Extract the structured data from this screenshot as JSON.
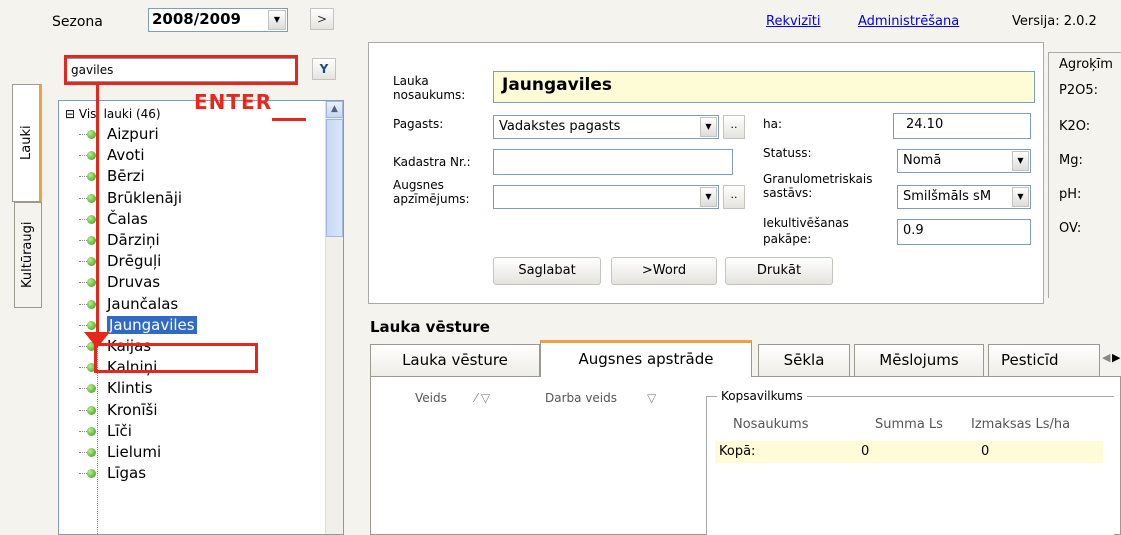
{
  "top": {
    "season_label": "Sezona",
    "season_value": "2008/2009",
    "next_btn": ">",
    "link_rekviziti": "Rekvizīti",
    "link_admin": "Administrēšana",
    "version": "Versija: 2.0.2"
  },
  "side_tabs": [
    "Lauki",
    "Kultūraugi"
  ],
  "search": {
    "value": "gaviles"
  },
  "annotation": {
    "enter": "ENTER"
  },
  "tree": {
    "root": "Visi lauki (46)",
    "items": [
      "Aizpuri",
      "Avoti",
      "Bērzi",
      "Brūklenāji",
      "Čalas",
      "Dārziņi",
      "Drēguļi",
      "Druvas",
      "Jaunčalas",
      "Jaungaviles",
      "Kaijas",
      "Kalniņi",
      "Klintis",
      "Kronīši",
      "Līči",
      "Lielumi",
      "Līgas"
    ],
    "selected": "Jaungaviles"
  },
  "form": {
    "name_label_1": "Lauka",
    "name_label_2": "nosaukums:",
    "name_value": "Jaungaviles",
    "pagasts_label": "Pagasts:",
    "pagasts_value": "Vadakstes pagasts",
    "ha_label": "ha:",
    "ha_value": "24.10",
    "kadastra_label": "Kadastra Nr.:",
    "kadastra_value": "",
    "statuss_label": "Statuss:",
    "statuss_value": "Nomā",
    "augsnes_label_1": "Augsnes",
    "augsnes_label_2": "apzīmējums:",
    "augsnes_value": "",
    "granulo_label_1": "Granulometriskais",
    "granulo_label_2": "sastāvs:",
    "granulo_value": "Smilšmāls sM",
    "iekult_label_1": "Iekultivēšanas",
    "iekult_label_2": "pakāpe:",
    "iekult_value": "0.9",
    "dots": "..",
    "btn_save": "Saglabat",
    "btn_word": ">Word",
    "btn_print": "Drukāt"
  },
  "agro": {
    "title": "Agroķīm",
    "rows": [
      "P2O5:",
      "K2O:",
      "Mg:",
      "pH:",
      "OV:"
    ]
  },
  "history": {
    "title": "Lauka vēsture",
    "tabs": [
      "Lauka vēsture",
      "Augsnes apstrāde",
      "Sēkla",
      "Mēslojums",
      "Pesticīd"
    ],
    "active_tab": "Augsnes apstrāde",
    "col_veids": "Veids",
    "col_darba": "Darba veids",
    "summary_title": "Kopsavilkums",
    "sum_col_name": "Nosaukums",
    "sum_col_sum": "Summa Ls",
    "sum_col_cost": "Izmaksas Ls/ha",
    "sum_row_label": "Kopā:",
    "sum_row_sum": "0",
    "sum_row_cost": "0"
  }
}
